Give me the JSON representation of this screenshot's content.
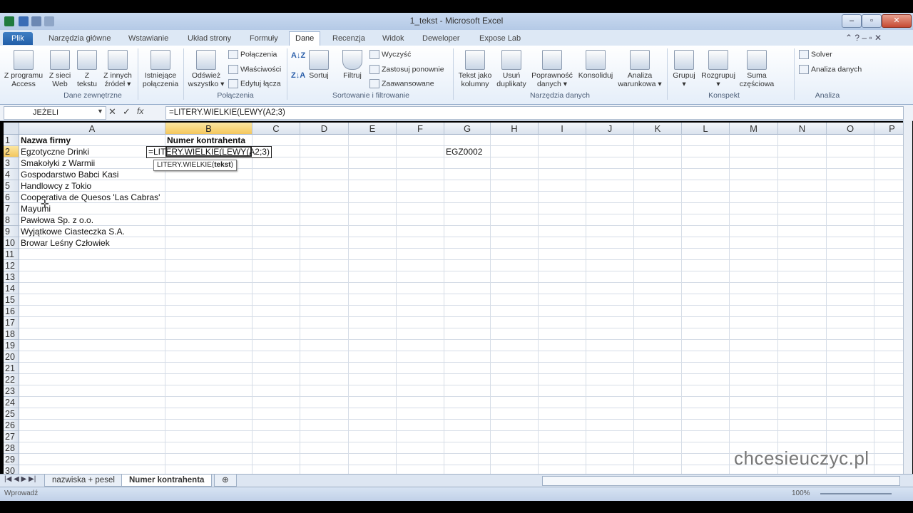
{
  "window": {
    "title": "1_tekst - Microsoft Excel",
    "buttons": [
      "–",
      "▫",
      "✕"
    ]
  },
  "ribbon_tabs": [
    {
      "label": "Plik"
    },
    {
      "label": "Narzędzia główne"
    },
    {
      "label": "Wstawianie"
    },
    {
      "label": "Układ strony"
    },
    {
      "label": "Formuły"
    },
    {
      "label": "Dane"
    },
    {
      "label": "Recenzja"
    },
    {
      "label": "Widok"
    },
    {
      "label": "Deweloper"
    },
    {
      "label": "Expose Lab"
    }
  ],
  "ribbon": {
    "groups": [
      {
        "label": "Dane zewnętrzne",
        "buttons": [
          "Z programu\nAccess",
          "Z sieci\nWeb",
          "Z\ntekstu",
          "Z innych\nźródeł ▾",
          "Istniejące\npołączenia"
        ]
      },
      {
        "label": "Połączenia",
        "buttons": [
          "Odśwież\nwszystko ▾"
        ],
        "small": [
          "Połączenia",
          "Właściwości",
          "Edytuj łącza"
        ]
      },
      {
        "label": "Sortowanie i filtrowanie",
        "buttons": [
          "Sortuj",
          "Filtruj"
        ],
        "small": [
          "Wyczyść",
          "Zastosuj ponownie",
          "Zaawansowane"
        ]
      },
      {
        "label": "Narzędzia danych",
        "buttons": [
          "Tekst jako\nkolumny",
          "Usuń\nduplikaty",
          "Poprawność\ndanych ▾",
          "Konsoliduj",
          "Analiza\nwarunkowa ▾"
        ]
      },
      {
        "label": "Konspekt",
        "buttons": [
          "Grupuj\n▾",
          "Rozgrupuj\n▾",
          "Suma\nczęściowa"
        ]
      },
      {
        "label": "Analiza",
        "small": [
          "Solver",
          "Analiza danych"
        ]
      }
    ]
  },
  "formula_bar": {
    "name_box": "JEŻELI",
    "formula": "=LITERY.WIELKIE(LEWY(A2;3)"
  },
  "columns": [
    "A",
    "B",
    "C",
    "D",
    "E",
    "F",
    "G",
    "H",
    "I",
    "J",
    "K",
    "L",
    "M",
    "N",
    "O",
    "P"
  ],
  "rows": [
    "1",
    "2",
    "3",
    "4",
    "5",
    "6",
    "7",
    "8",
    "9",
    "10",
    "11",
    "12",
    "13",
    "14",
    "15",
    "16",
    "17",
    "18",
    "19",
    "20",
    "21",
    "22",
    "23",
    "24",
    "25",
    "26",
    "27",
    "28",
    "29",
    "30"
  ],
  "cells": {
    "A1": "Nazwa firmy",
    "B1": "Numer kontrahenta",
    "A2": "Egzotyczne Drinki",
    "B2": "=LITERY.WIELKIE(LEWY(A2;3)",
    "G2": "EGZ0002",
    "A3": "Smakołyki z Warmii",
    "A4": "Gospodarstwo Babci Kasi",
    "A5": "Handlowcy z Tokio",
    "A6": "Cooperativa de Quesos 'Las Cabras'",
    "A7": "Mayumi",
    "A8": "Pawłowa Sp. z o.o.",
    "A9": "Wyjątkowe Ciasteczka S.A.",
    "A10": "Browar Leśny Człowiek"
  },
  "tooltip": {
    "name": "LITERY.WIELKIE(",
    "arg": "tekst",
    "close": ")"
  },
  "sheet_tabs": [
    {
      "label": "nazwiska + pesel",
      "active": false
    },
    {
      "label": "Numer kontrahenta",
      "active": true
    }
  ],
  "status": {
    "mode": "Wprowadź",
    "zoom": "100%"
  },
  "watermark": "chcesieuczyc.pl",
  "colors": {
    "accent": "#2a5ea9",
    "selected_header": "#f4c75d"
  }
}
